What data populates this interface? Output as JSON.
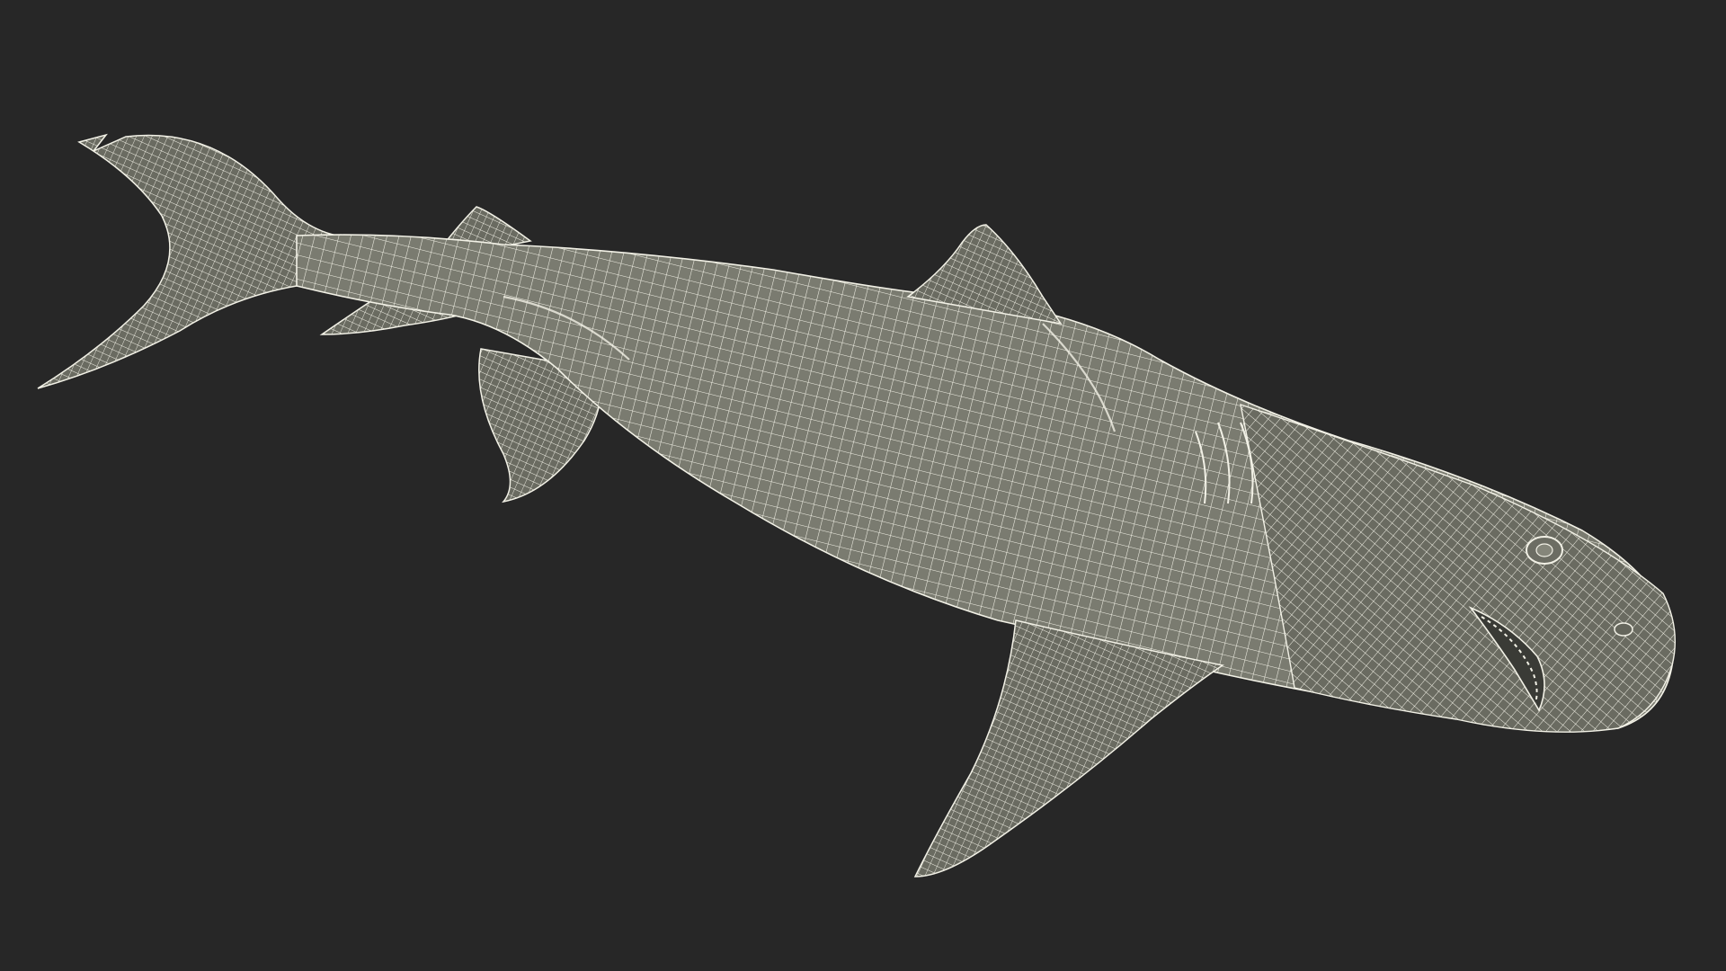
{
  "scene": {
    "background_color": "#272727",
    "model_fill_color": "#7a7b70",
    "model_shade_color": "#6a6b61",
    "wireframe_color": "#f2f1e6",
    "subject": "shark-wireframe-model"
  }
}
